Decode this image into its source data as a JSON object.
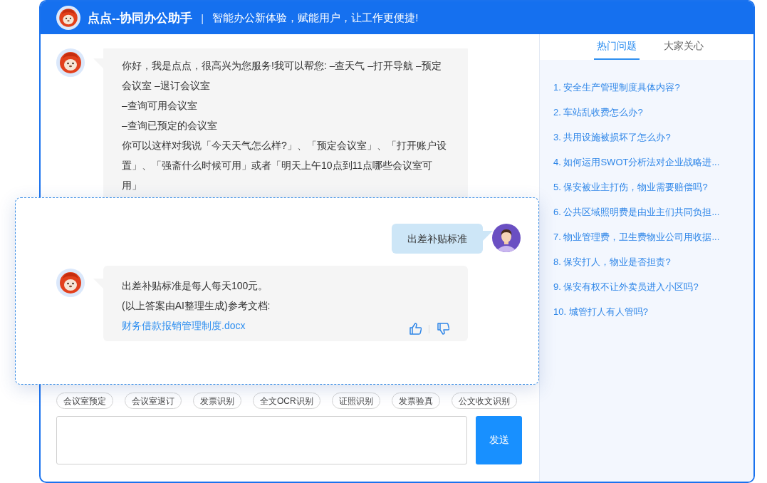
{
  "header": {
    "title": "点点--协同办公助手",
    "separator": "|",
    "subtitle": "智能办公新体验，赋能用户，让工作更便捷!"
  },
  "chat": {
    "messages": [
      {
        "kind": "greeting",
        "paragraphs": [
          "你好，我是点点，很高兴为您服务!我可以帮您: –查天气 –打开导航 –预定会议室 –退订会议室",
          "–查询可用会议室",
          "–查询已预定的会议室",
          "你可以这样对我说「今天天气怎么样?」、「预定会议室」、「打开账户设置」、「强斋什么时候可用」或者「明天上午10点到11点哪些会议室可用」"
        ]
      }
    ]
  },
  "overlay_card": {
    "messages": [
      {
        "kind": "question",
        "paragraphs": [
          "出差补贴标准"
        ]
      },
      {
        "kind": "answer",
        "paragraphs": [
          "出差补贴标准是每人每天100元。",
          "(以上答案由AI整理生成)参考文档:"
        ],
        "link": "财务借款报销管理制度.docx"
      }
    ]
  },
  "quick_replies": [
    "会议室预定",
    "会议室退订",
    "发票识别",
    "全文OCR识别",
    "证照识别",
    "发票验真",
    "公文收文识别"
  ],
  "composer": {
    "send_button": "发送"
  },
  "side_panel": {
    "tabs": [
      {
        "label": "热门问题",
        "selected": true
      },
      {
        "label": "大家关心",
        "selected": false
      }
    ],
    "questions": [
      "1. 安全生产管理制度具体内容?",
      "2. 车站乱收费怎么办?",
      "3. 共用设施被损坏了怎么办?",
      "4. 如何运用SWOT分析法对企业战略进...",
      "5. 保安被业主打伤，物业需要赔偿吗?",
      "6. 公共区域照明费是由业主们共同负担...",
      "7. 物业管理费，卫生费物业公司用收据...",
      "8. 保安打人，物业是否担责?",
      "9. 保安有权不让外卖员进入小区吗?",
      "10. 城管打人有人管吗?"
    ]
  }
}
